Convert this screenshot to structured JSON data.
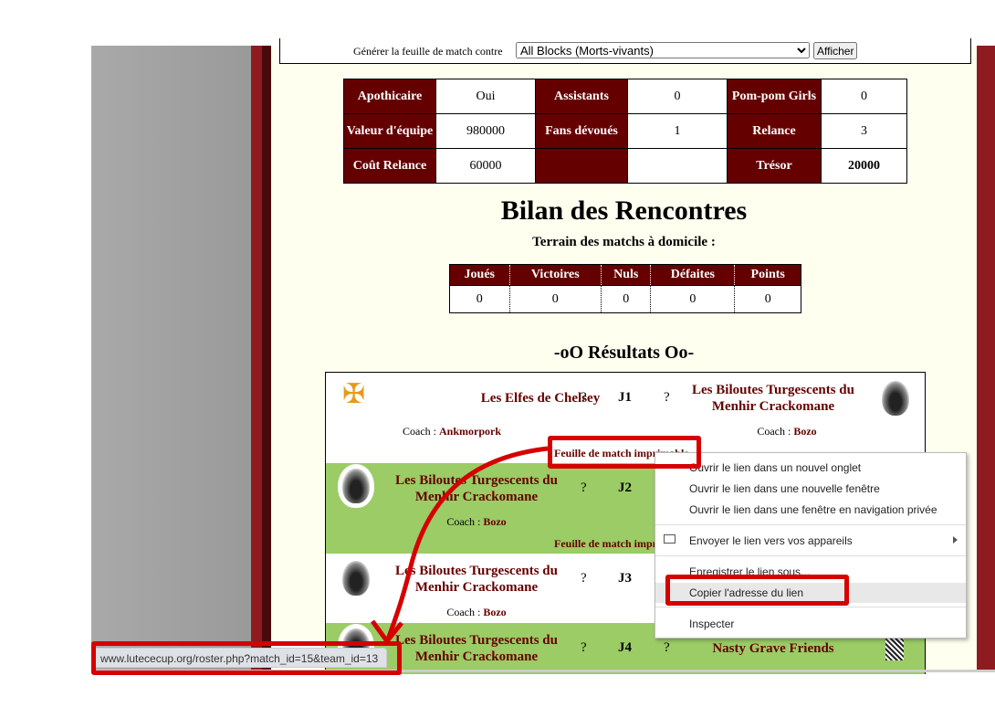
{
  "generator": {
    "label": "Générer la feuille de match contre",
    "selected": "All Blocks (Morts-vivants)",
    "button": "Afficher"
  },
  "stats": [
    [
      {
        "h": "Apothicaire",
        "v": "Oui"
      },
      {
        "h": "Assistants",
        "v": "0"
      },
      {
        "h": "Pom-pom Girls",
        "v": "0"
      }
    ],
    [
      {
        "h": "Valeur d'équipe",
        "v": "980000"
      },
      {
        "h": "Fans dévoués",
        "v": "1"
      },
      {
        "h": "Relance",
        "v": "3"
      }
    ],
    [
      {
        "h": "Coût Relance",
        "v": "60000"
      },
      {
        "h": "",
        "v": ""
      },
      {
        "h": "Trésor",
        "v": "20000"
      }
    ]
  ],
  "bilan": {
    "title": "Bilan des Rencontres",
    "subtitle": "Terrain des matchs à domicile :",
    "headers": [
      "Joués",
      "Victoires",
      "Nuls",
      "Défaites",
      "Points"
    ],
    "values": [
      "0",
      "0",
      "0",
      "0",
      "0"
    ]
  },
  "results": {
    "title": "-oO Résultats Oo-",
    "coach_prefix": "Coach : ",
    "sheet_label": "Feuille de match imprimable",
    "matches": [
      {
        "home": "Les Elfes de Chelsey",
        "home_coach": "Ankmorpork",
        "hs": "?",
        "round": "J1",
        "as": "?",
        "away": "Les Biloutes Turgescents du Menhir Crackomane",
        "away_coach": "Bozo",
        "bg": "#ffffff"
      },
      {
        "home": "Les Biloutes Turgescents du Menhir Crackomane",
        "home_coach": "Bozo",
        "hs": "?",
        "round": "J2",
        "bg": "#9bcc66"
      },
      {
        "home": "Les Biloutes Turgescents du Menhir Crackomane",
        "home_coach": "Bozo",
        "hs": "?",
        "round": "J3",
        "bg": "#ffffff"
      },
      {
        "home": "Les Biloutes Turgescents du Menhir Crackomane",
        "hs": "?",
        "round": "J4",
        "as": "?",
        "away": "Nasty Grave Friends",
        "bg": "#9bcc66"
      }
    ]
  },
  "context_menu": {
    "items": [
      "Ouvrir le lien dans un nouvel onglet",
      "Ouvrir le lien dans une nouvelle fenêtre",
      "Ouvrir le lien dans une fenêtre en navigation privée",
      "Envoyer le lien vers vos appareils",
      "Enregistrer le lien sous...",
      "Copier l'adresse du lien",
      "Inspecter"
    ]
  },
  "status_url": "www.lutececup.org/roster.php?match_id=15&team_id=13",
  "colors": {
    "header": "#650000",
    "green": "#9bcc66",
    "annotation": "#d50000"
  }
}
